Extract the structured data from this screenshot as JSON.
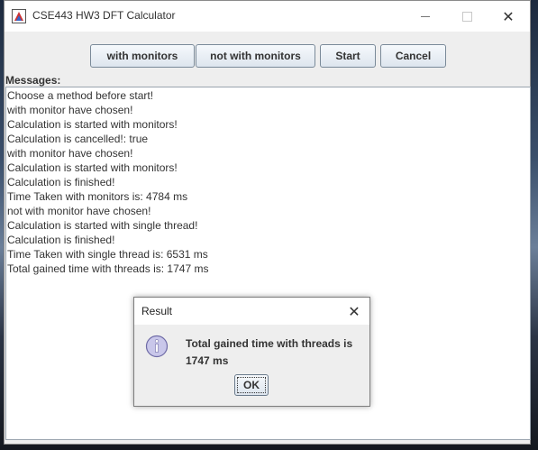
{
  "window": {
    "title": "CSE443 HW3 DFT Calculator",
    "close_glyph": "✕"
  },
  "toolbar": {
    "with_monitors_label": "with monitors",
    "not_with_monitors_label": "not with monitors",
    "start_label": "Start",
    "cancel_label": "Cancel"
  },
  "messages": {
    "label": "Messages:",
    "lines": [
      "Choose a method before start!",
      "with monitor have chosen!",
      "Calculation is started with monitors!",
      "Calculation is cancelled!: true",
      "with monitor have chosen!",
      "Calculation is started with monitors!",
      "Calculation is finished!",
      "Time Taken with monitors is: 4784 ms",
      "not with monitor have chosen!",
      "Calculation is started with single thread!",
      "Calculation is finished!",
      "Time Taken with single thread is: 6531 ms",
      "Total gained time with threads is: 1747 ms"
    ]
  },
  "dialog": {
    "title": "Result",
    "close_glyph": "✕",
    "message_line1": "Total gained time with threads is",
    "message_line2": "1747 ms",
    "ok_label": "OK",
    "icon": "info-icon"
  },
  "colors": {
    "button_border": "#7a8a99",
    "info_icon_fill": "#c9c7ea",
    "info_icon_stroke": "#6e6aa6"
  }
}
